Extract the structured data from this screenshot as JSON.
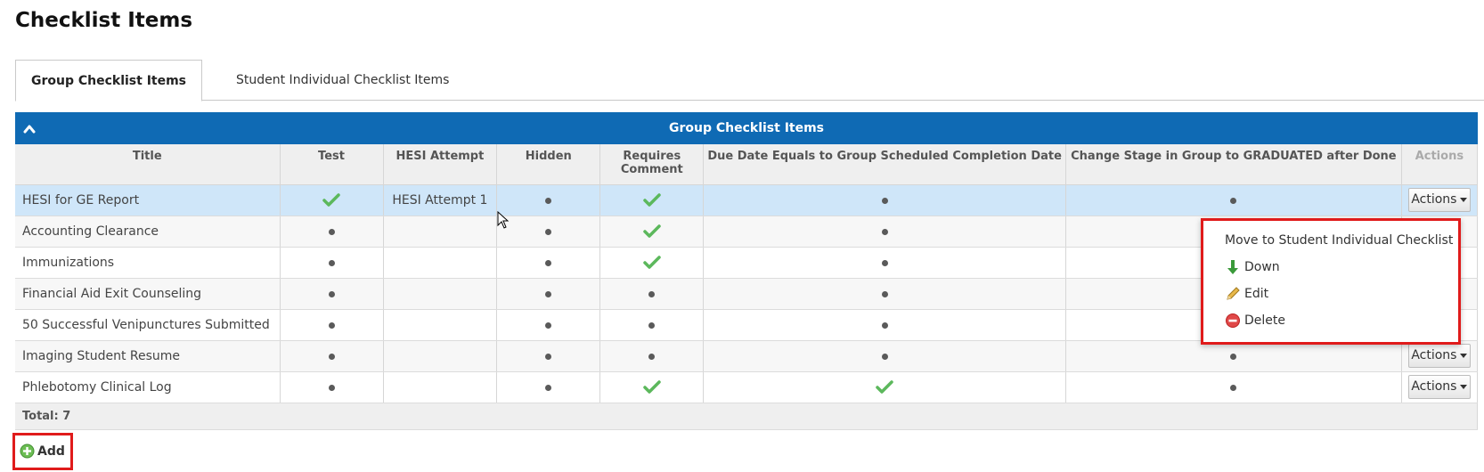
{
  "page": {
    "title": "Checklist Items"
  },
  "tabs": [
    {
      "label": "Group Checklist Items",
      "active": true
    },
    {
      "label": "Student Individual Checklist Items",
      "active": false
    }
  ],
  "grid": {
    "header_title": "Group Checklist Items",
    "columns": [
      "Title",
      "Test",
      "HESI Attempt",
      "Hidden",
      "Requires Comment",
      "Due Date Equals to Group Scheduled Completion Date",
      "Change Stage in Group to GRADUATED after Done",
      "Actions"
    ],
    "rows": [
      {
        "title": "HESI for GE Report",
        "test": "check",
        "hesi_attempt": "HESI Attempt 1",
        "hidden": "dot",
        "requires_comment": "check",
        "due_date": "dot",
        "change_stage": "dot",
        "actions": "Actions",
        "selected": true
      },
      {
        "title": "Accounting Clearance",
        "test": "dot",
        "hesi_attempt": "",
        "hidden": "dot",
        "requires_comment": "check",
        "due_date": "dot",
        "change_stage": "dot",
        "actions": ""
      },
      {
        "title": "Immunizations",
        "test": "dot",
        "hesi_attempt": "",
        "hidden": "dot",
        "requires_comment": "check",
        "due_date": "dot",
        "change_stage": "dot",
        "actions": ""
      },
      {
        "title": "Financial Aid Exit Counseling",
        "test": "dot",
        "hesi_attempt": "",
        "hidden": "dot",
        "requires_comment": "dot",
        "due_date": "dot",
        "change_stage": "dot",
        "actions": ""
      },
      {
        "title": "50 Successful Venipunctures Submitted",
        "test": "dot",
        "hesi_attempt": "",
        "hidden": "dot",
        "requires_comment": "dot",
        "due_date": "dot",
        "change_stage": "dot",
        "actions": ""
      },
      {
        "title": "Imaging Student Resume",
        "test": "dot",
        "hesi_attempt": "",
        "hidden": "dot",
        "requires_comment": "dot",
        "due_date": "dot",
        "change_stage": "dot",
        "actions": "Actions"
      },
      {
        "title": "Phlebotomy Clinical Log",
        "test": "dot",
        "hesi_attempt": "",
        "hidden": "dot",
        "requires_comment": "check",
        "due_date": "check",
        "change_stage": "dot",
        "actions": "Actions"
      }
    ],
    "footer": "Total: 7"
  },
  "dropdown": {
    "items": [
      {
        "label": "Move to Student Individual Checklist",
        "icon": "none"
      },
      {
        "label": "Down",
        "icon": "down-arrow-icon"
      },
      {
        "label": "Edit",
        "icon": "pencil-icon"
      },
      {
        "label": "Delete",
        "icon": "delete-icon"
      }
    ]
  },
  "add_button": {
    "label": "Add",
    "icon": "add-icon"
  },
  "colors": {
    "header_blue": "#0f6ab4",
    "check_green": "#5cb85c",
    "highlight_red": "#e01b1b",
    "selected_row": "#cfe6f9"
  }
}
